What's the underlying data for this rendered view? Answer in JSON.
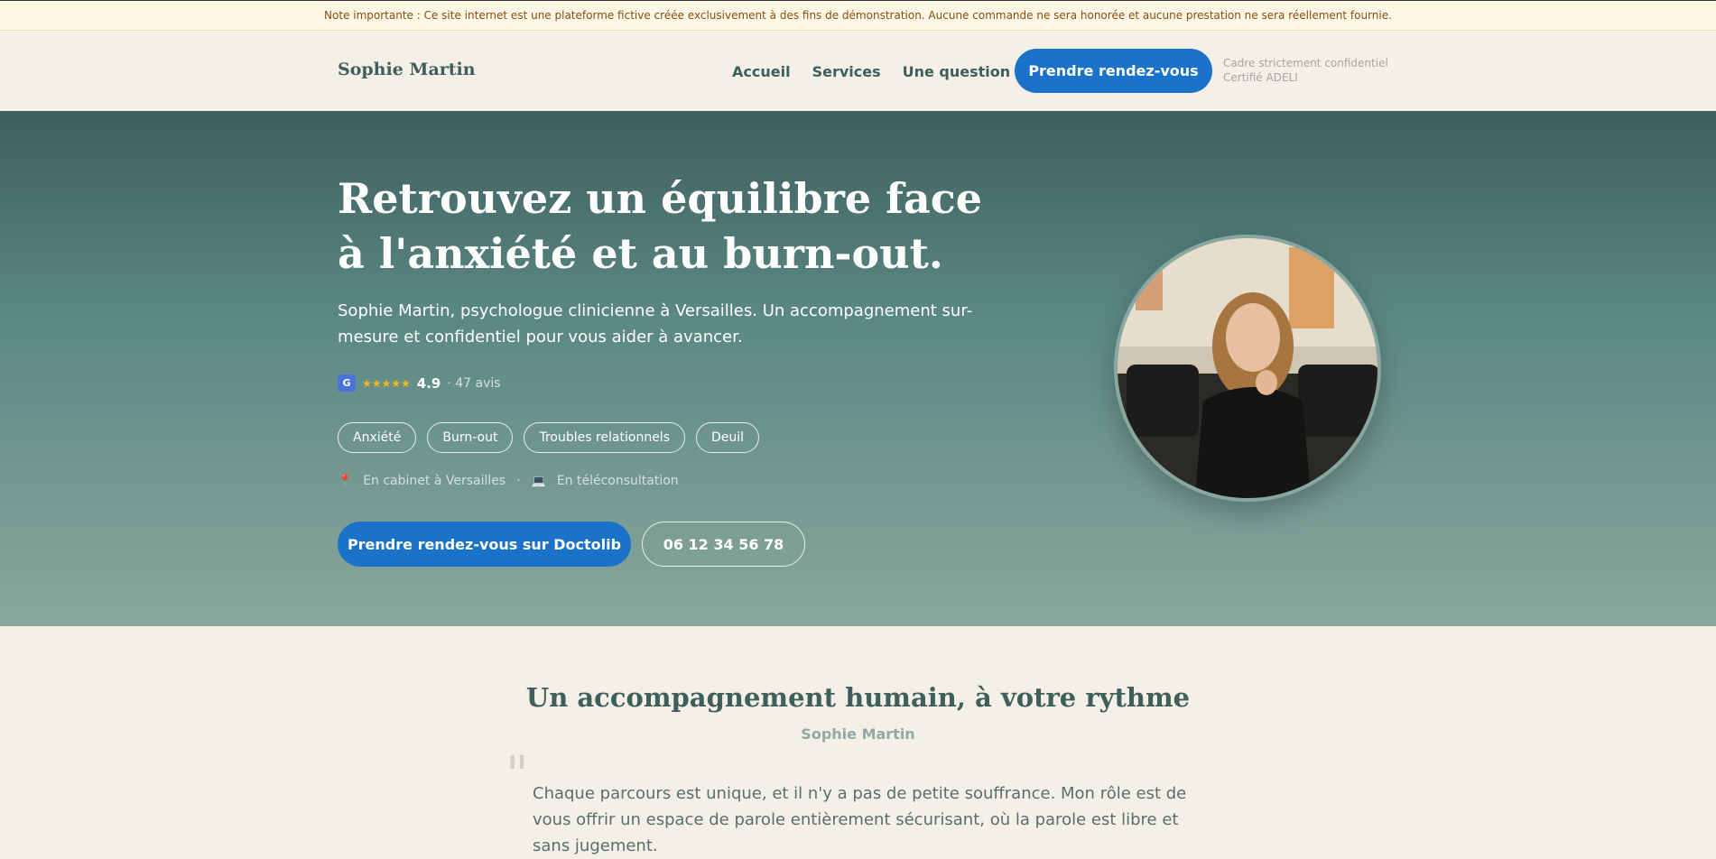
{
  "notice": "Note importante : Ce site internet est une plateforme fictive créée exclusivement à des fins de démonstration. Aucune commande ne sera honorée et aucune prestation ne sera réellement fournie.",
  "nav": {
    "brand": "Sophie Martin",
    "items": [
      "Accueil",
      "Services",
      "Une question ?"
    ],
    "cta": "Prendre rendez-vous",
    "note_line1": "Cadre strictement confidentiel",
    "note_line2": "Certifié ADELI"
  },
  "hero": {
    "title": "Retrouvez un équilibre face à l'anxiété et au burn-out.",
    "subtitle": "Sophie Martin, psychologue clinicienne à Versailles. Un accompagnement sur-mesure et confidentiel pour vous aider à avancer.",
    "rating": {
      "badge": "G",
      "stars": "★★★★★",
      "score": "4.9",
      "count": "· 47 avis"
    },
    "tags": [
      "Anxiété",
      "Burn-out",
      "Troubles relationnels",
      "Deuil"
    ],
    "locations": {
      "cabinet": "En cabinet à Versailles",
      "separator": "·",
      "tele": "En téléconsultation"
    },
    "cta_primary": "Prendre rendez-vous sur Doctolib",
    "cta_phone": "06 12 34 56 78"
  },
  "about": {
    "title": "Un accompagnement humain, à votre rythme",
    "author": "Sophie Martin",
    "quote": "Chaque parcours est unique, et il n'y a pas de petite souffrance. Mon rôle est de vous offrir un espace de parole entièrement sécurisant, où la parole est libre et sans jugement."
  },
  "colors": {
    "accent": "#1a73c8",
    "teal": "#3e5f5a",
    "cream": "#f4efe7"
  }
}
